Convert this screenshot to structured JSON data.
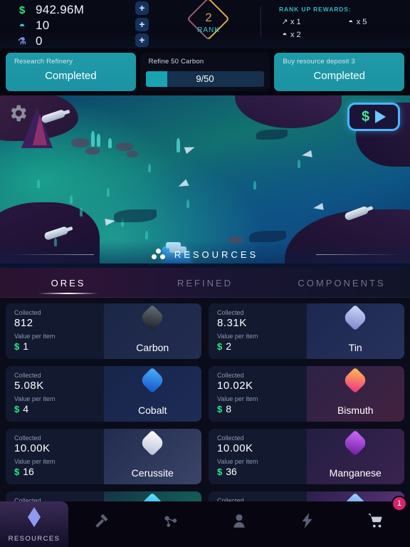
{
  "topbar": {
    "currencies": [
      {
        "icon": "dollar-icon",
        "glyph": "$",
        "value": "942.96M"
      },
      {
        "icon": "gem-icon",
        "glyph": "◓",
        "value": "10"
      },
      {
        "icon": "flask-icon",
        "glyph": "⚗",
        "value": "0"
      }
    ],
    "plus_label": "+",
    "rank": {
      "number": "2",
      "label": "RANK"
    },
    "rewards": {
      "title": "RANK UP REWARDS:",
      "items": [
        {
          "icon": "rocket-icon",
          "glyph": "↗",
          "amount": "x 1"
        },
        {
          "icon": "gem-icon",
          "glyph": "◓",
          "amount": "x 5"
        },
        {
          "icon": "gem-icon",
          "glyph": "◓",
          "amount": "x 2"
        }
      ]
    }
  },
  "objectives": [
    {
      "title": "Research Refinery",
      "status": "Completed",
      "completed": true
    },
    {
      "title": "Refine 50 Carbon",
      "progress_text": "9/50",
      "percent": 18,
      "completed": false
    },
    {
      "title": "Buy resource deposit 3",
      "status": "Completed",
      "completed": true
    }
  ],
  "map": {
    "settings_icon": "gear-icon",
    "money_button": {
      "currency_glyph": "$",
      "play_glyph": "play-icon"
    }
  },
  "resources_header": {
    "title": "RESOURCES",
    "icon": "resources-dots-icon"
  },
  "tabs": [
    {
      "label": "ORES",
      "active": true
    },
    {
      "label": "REFINED",
      "active": false
    },
    {
      "label": "COMPONENTS",
      "active": false
    }
  ],
  "card_labels": {
    "collected": "Collected",
    "value_per_item": "Value per item",
    "currency": "$"
  },
  "resources": [
    {
      "name": "Carbon",
      "collected": "812",
      "value": "1",
      "gem": "g-carbon",
      "panel": "rp-carbon"
    },
    {
      "name": "Tin",
      "collected": "8.31K",
      "value": "2",
      "gem": "g-tin",
      "panel": "rp-tin"
    },
    {
      "name": "Cobalt",
      "collected": "5.08K",
      "value": "4",
      "gem": "g-cobalt",
      "panel": "rp-cobalt"
    },
    {
      "name": "Bismuth",
      "collected": "10.02K",
      "value": "8",
      "gem": "g-bismuth",
      "panel": "rp-bismuth"
    },
    {
      "name": "Cerussite",
      "collected": "10.00K",
      "value": "16",
      "gem": "g-cerussite",
      "panel": "rp-cerussite"
    },
    {
      "name": "Manganese",
      "collected": "10.00K",
      "value": "36",
      "gem": "g-manganese",
      "panel": "rp-manganese"
    }
  ],
  "partial_resources": [
    {
      "collected_label": "Collected",
      "gem": "g-part1",
      "panel": "rp-partial1"
    },
    {
      "collected_label": "Collected",
      "gem": "g-part2",
      "panel": "rp-partial2"
    }
  ],
  "nav": {
    "items": [
      {
        "label": "RESOURCES",
        "icon": "diamond-icon",
        "active": true
      },
      {
        "label": "",
        "icon": "hammer-icon",
        "active": false
      },
      {
        "label": "",
        "icon": "molecule-icon",
        "active": false
      },
      {
        "label": "",
        "icon": "person-icon",
        "active": false
      },
      {
        "label": "",
        "icon": "bolt-icon",
        "active": false
      },
      {
        "label": "",
        "icon": "cart-icon",
        "active": false
      }
    ],
    "cart_badge": "1"
  },
  "colors": {
    "money_green": "#2ee87f",
    "teal": "#1aa3b0",
    "accent_blue": "#46b8ff",
    "badge_pink": "#d6246a"
  }
}
